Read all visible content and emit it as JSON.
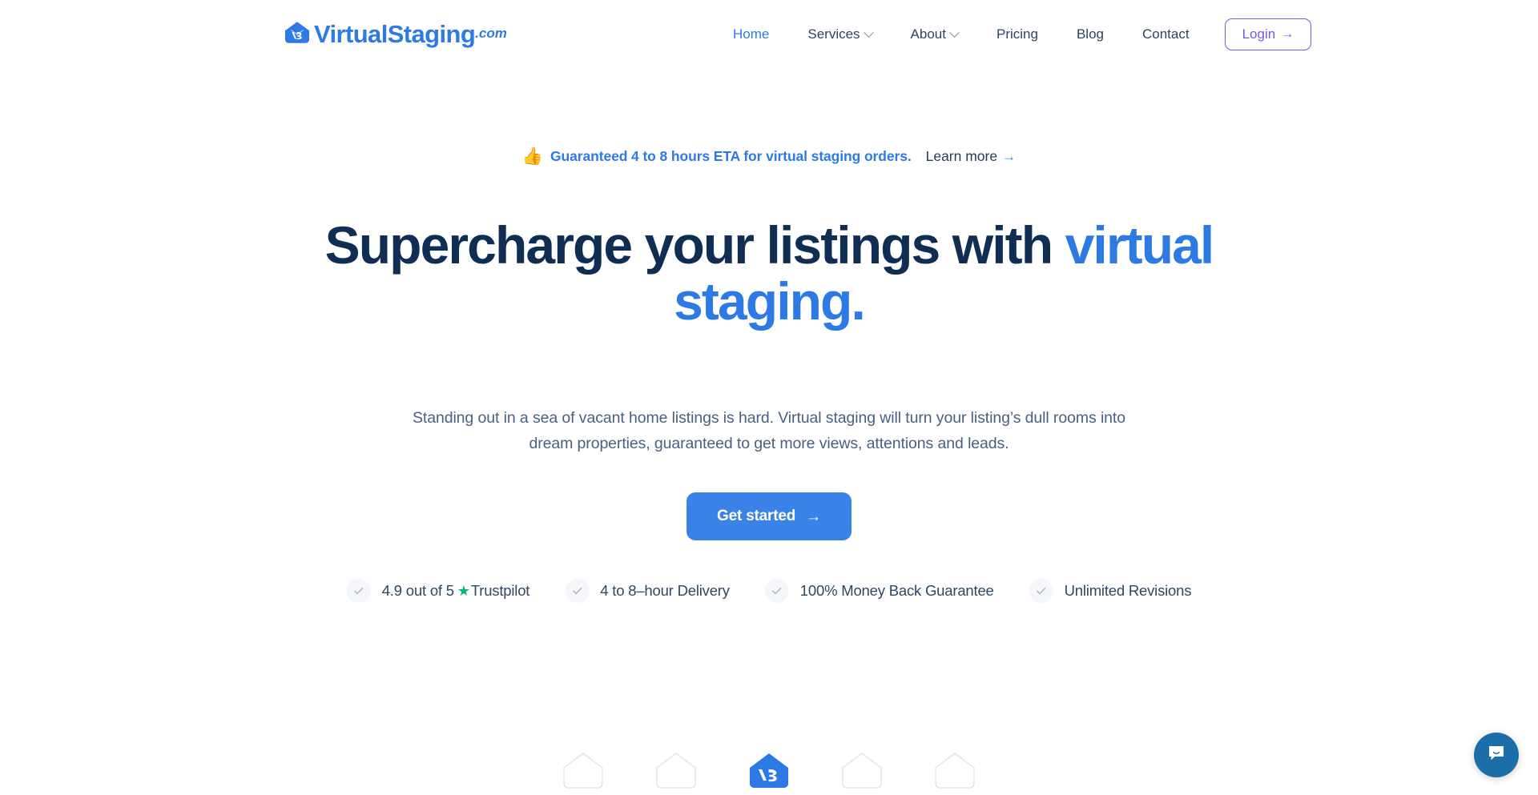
{
  "colors": {
    "brand_blue": "#2d7ae5",
    "cta_blue": "#3b82e8",
    "headline_navy": "#102e53",
    "body_text": "#4a6080",
    "login_purple": "#6c5ce7",
    "trustpilot_green": "#00b67a",
    "chat_blue": "#1b6ea8",
    "page_background": "#ffffff"
  },
  "header": {
    "logo": {
      "icon": "house-vs-monogram-icon",
      "wordmark": "VirtualStaging",
      "suffix": ".com"
    },
    "nav": [
      {
        "label": "Home",
        "active": true,
        "has_dropdown": false
      },
      {
        "label": "Services",
        "active": false,
        "has_dropdown": true
      },
      {
        "label": "About",
        "active": false,
        "has_dropdown": true
      },
      {
        "label": "Pricing",
        "active": false,
        "has_dropdown": false
      },
      {
        "label": "Blog",
        "active": false,
        "has_dropdown": false
      },
      {
        "label": "Contact",
        "active": false,
        "has_dropdown": false
      }
    ],
    "login": {
      "label": "Login",
      "arrow": "→"
    }
  },
  "announcement": {
    "emoji": "👍",
    "text": "Guaranteed 4 to 8 hours ETA for virtual staging orders.",
    "link_label": "Learn more",
    "link_arrow": "→"
  },
  "hero": {
    "title_plain": "Supercharge your listings with ",
    "title_accent": "virtual staging.",
    "subtitle_line1": "Standing out in a sea of vacant home listings is hard. Virtual staging will turn your listing’s dull rooms",
    "subtitle_line2": "into dream properties, guaranteed to get more views, attentions and leads.",
    "cta_label": "Get started",
    "cta_arrow": "→"
  },
  "features": [
    {
      "label_prefix": "4.9 out of 5 ",
      "star": "★",
      "label_suffix": "Trustpilot",
      "check": "✓"
    },
    {
      "label_prefix": "4 to 8–hour Delivery",
      "star": "",
      "label_suffix": "",
      "check": "✓"
    },
    {
      "label_prefix": "100% Money Back Guarantee",
      "star": "",
      "label_suffix": "",
      "check": "✓"
    },
    {
      "label_prefix": "Unlimited Revisions",
      "star": "",
      "label_suffix": "",
      "check": "✓"
    }
  ],
  "logo_strip": {
    "count": 5,
    "active_index": 2,
    "icon": "house-vs-monogram-icon"
  },
  "chat": {
    "icon": "chat-bubble-icon",
    "label": "Open chat"
  }
}
